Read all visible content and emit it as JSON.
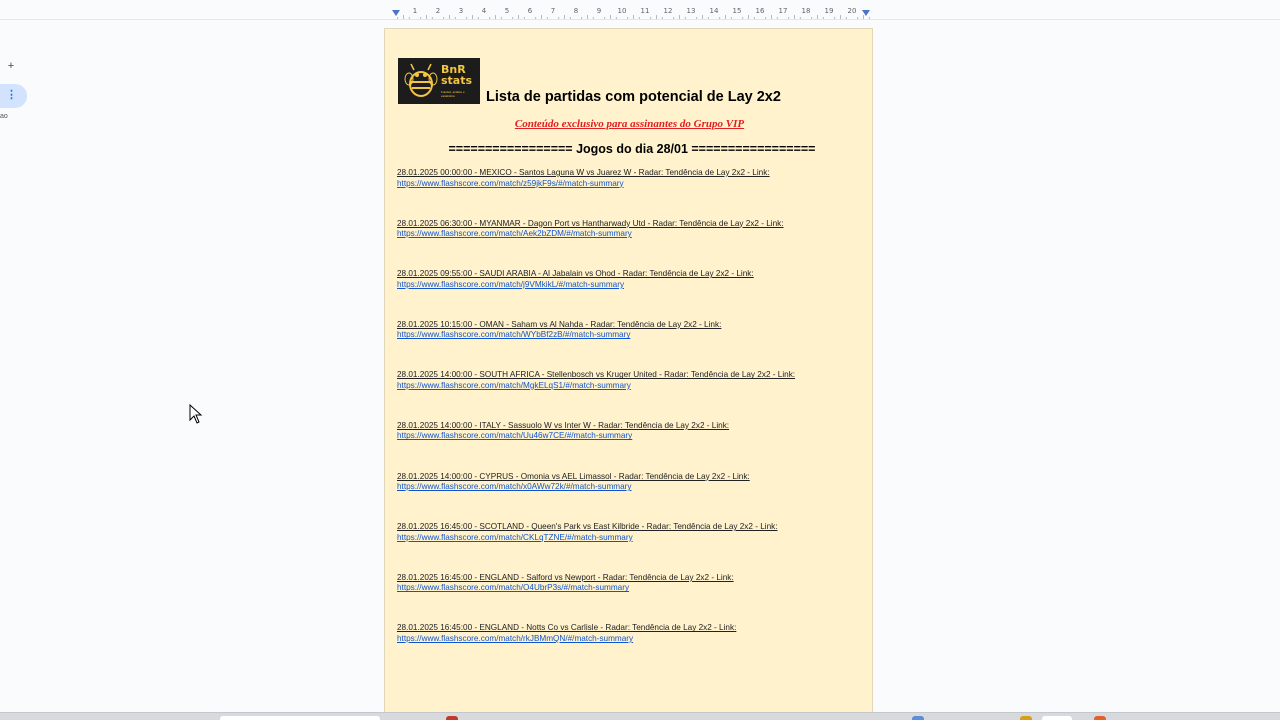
{
  "sidebar": {
    "add_symbol": "+",
    "tab_symbol": "⋮",
    "label": "ao"
  },
  "ruler": {
    "numbers": [
      "1",
      "2",
      "3",
      "4",
      "5",
      "6",
      "7",
      "8",
      "9",
      "10",
      "11",
      "12",
      "13",
      "14",
      "15",
      "16",
      "17",
      "18",
      "19",
      "20"
    ]
  },
  "document": {
    "logo": {
      "text_line1": "BnR",
      "text_line2": "stats",
      "tagline": "Futebol, análise e estatística"
    },
    "title": "Lista de partidas com potencial de Lay 2x2",
    "subtitle": "Conteúdo exclusivo para assinantes do Grupo VIP",
    "section_heading": "================= Jogos do dia 28/01 =================",
    "matches": [
      {
        "text": "28.01.2025 00:00:00 - MEXICO - Santos Laguna W vs Juarez W - Radar: Tendência de Lay 2x2 - Link:",
        "link": "https://www.flashscore.com/match/z59jkF9s/#/match-summary"
      },
      {
        "text": "28.01.2025 06:30:00 - MYANMAR - Dagon Port vs Hantharwady Utd - Radar: Tendência de Lay 2x2 - Link:",
        "link": "https://www.flashscore.com/match/Aek2bZDM/#/match-summary"
      },
      {
        "text": "28.01.2025 09:55:00 - SAUDI ARABIA - Al Jabalain vs Ohod - Radar: Tendência de Lay 2x2 - Link:",
        "link": "https://www.flashscore.com/match/j9VMkikL/#/match-summary"
      },
      {
        "text": "28.01.2025 10:15:00 - OMAN - Saham vs Al Nahda - Radar: Tendência de Lay 2x2 - Link:",
        "link": "https://www.flashscore.com/match/WYbBf2zB/#/match-summary"
      },
      {
        "text": "28.01.2025 14:00:00 - SOUTH AFRICA - Stellenbosch vs Kruger United - Radar: Tendência de Lay 2x2 - Link:",
        "link": "https://www.flashscore.com/match/MgkELqS1/#/match-summary"
      },
      {
        "text": "28.01.2025 14:00:00 - ITALY - Sassuolo W vs Inter W - Radar: Tendência de Lay 2x2 - Link:",
        "link": "https://www.flashscore.com/match/Uu46w7CE/#/match-summary"
      },
      {
        "text": "28.01.2025 14:00:00 - CYPRUS - Omonia vs AEL Limassol - Radar: Tendência de Lay 2x2 - Link:",
        "link": "https://www.flashscore.com/match/x0AWw72k/#/match-summary"
      },
      {
        "text": "28.01.2025 16:45:00 - SCOTLAND - Queen's Park vs East Kilbride - Radar: Tendência de Lay 2x2 - Link:",
        "link": "https://www.flashscore.com/match/CKLqTZNE/#/match-summary"
      },
      {
        "text": "28.01.2025 16:45:00 - ENGLAND - Salford vs Newport - Radar: Tendência de Lay 2x2 - Link:",
        "link": "https://www.flashscore.com/match/O4UbrP3s/#/match-summary"
      },
      {
        "text": "28.01.2025 16:45:00 - ENGLAND - Notts Co vs Carlisle - Radar: Tendência de Lay 2x2 - Link:",
        "link": "https://www.flashscore.com/match/rkJBMmQN/#/match-summary"
      }
    ]
  },
  "colors": {
    "page_background": "#fff2cc",
    "subtitle": "#e02020",
    "link": "#1155cc",
    "logo_gold": "#f4c542"
  }
}
